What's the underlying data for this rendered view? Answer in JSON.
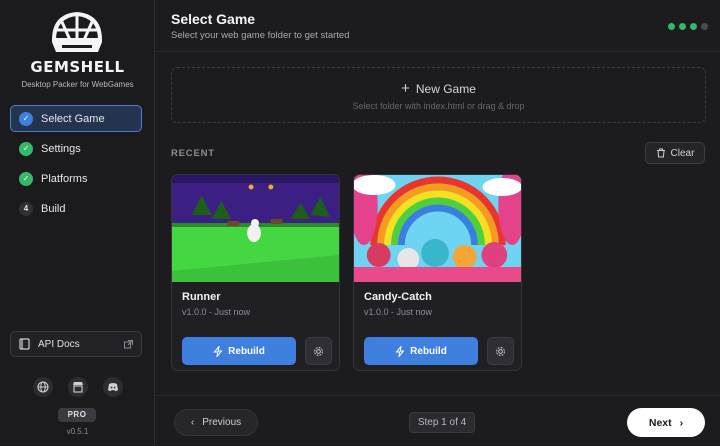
{
  "sidebar": {
    "brand": "GEMSHELL",
    "tagline": "Desktop Packer for WebGames",
    "steps": [
      {
        "label": "Select Game",
        "badge": "✓",
        "state": "current"
      },
      {
        "label": "Settings",
        "badge": "✓",
        "state": "done"
      },
      {
        "label": "Platforms",
        "badge": "✓",
        "state": "done"
      },
      {
        "label": "Build",
        "badge": "4",
        "state": "pending"
      }
    ],
    "api_docs_label": "API Docs",
    "social_icons": [
      "globe-icon",
      "store-icon",
      "discord-icon"
    ],
    "plan_badge": "PRO",
    "version": "v0.5.1"
  },
  "header": {
    "title": "Select Game",
    "subtitle": "Select your web game folder to get started",
    "progress": {
      "completed": 3,
      "total": 4
    }
  },
  "dropzone": {
    "title": "New Game",
    "hint": "Select folder with index.html or drag & drop"
  },
  "recent": {
    "label": "RECENT",
    "clear_label": "Clear",
    "games": [
      {
        "name": "Runner",
        "meta": "v1.0.0 - Just now",
        "rebuild_label": "Rebuild"
      },
      {
        "name": "Candy-Catch",
        "meta": "v1.0.0 - Just now",
        "rebuild_label": "Rebuild"
      }
    ]
  },
  "footer": {
    "previous_label": "Previous",
    "step_indicator": "Step 1 of 4",
    "next_label": "Next"
  },
  "colors": {
    "accent": "#3f7fe0",
    "success": "#35b86b",
    "background": "#1c1c1f"
  }
}
